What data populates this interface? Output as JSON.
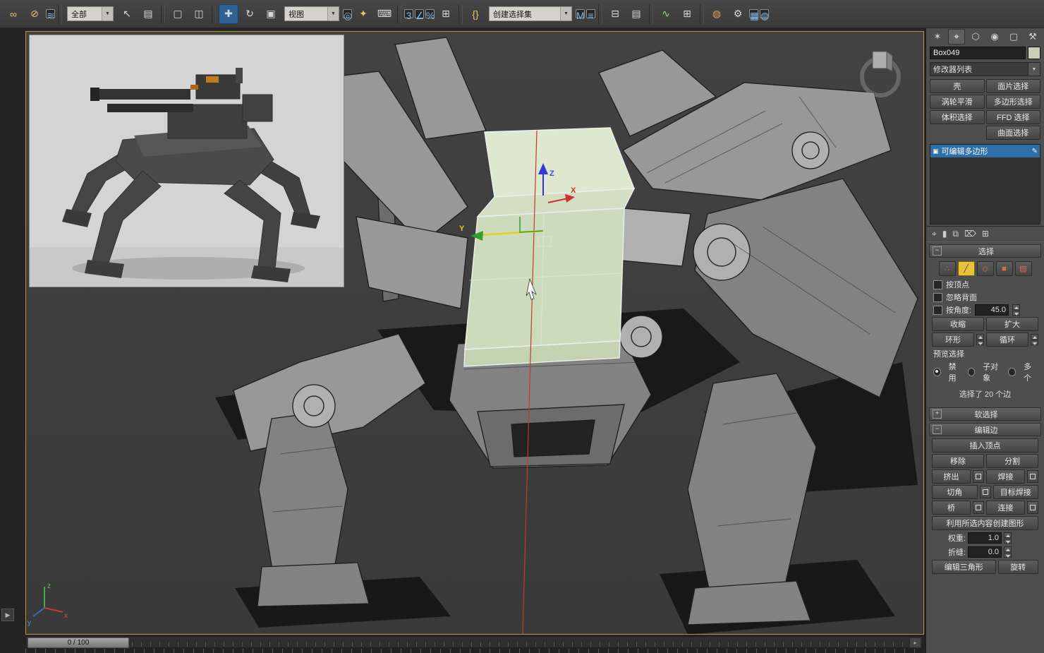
{
  "toolbar": {
    "filter_dropdown": "全部",
    "coord_dropdown": "视图",
    "selection_set_dropdown": "创建选择集",
    "icons": [
      {
        "name": "select-and-link",
        "glyph": "∞"
      },
      {
        "name": "unlink-selection",
        "glyph": "⊘"
      },
      {
        "name": "bind-to-space-warp",
        "glyph": "≋"
      },
      {
        "name": "select-object",
        "glyph": "↖"
      },
      {
        "name": "select-by-name",
        "glyph": "▤"
      },
      {
        "name": "selection-region",
        "glyph": "▢"
      },
      {
        "name": "window-crossing",
        "glyph": "◫"
      },
      {
        "name": "select-and-move",
        "glyph": "✚"
      },
      {
        "name": "select-and-rotate",
        "glyph": "↻"
      },
      {
        "name": "select-and-scale",
        "glyph": "▣"
      },
      {
        "name": "use-pivot-point-center",
        "glyph": "◎"
      },
      {
        "name": "select-and-manipulate",
        "glyph": "✦"
      },
      {
        "name": "keyboard-shortcut-override",
        "glyph": "⌨"
      },
      {
        "name": "snaps-toggle-3d",
        "glyph": "3"
      },
      {
        "name": "angle-snap-toggle",
        "glyph": "∠"
      },
      {
        "name": "percent-snap-toggle",
        "glyph": "%"
      },
      {
        "name": "spinner-snap-toggle",
        "glyph": "⊞"
      },
      {
        "name": "edit-named-selection-sets",
        "glyph": "{}"
      },
      {
        "name": "mirror",
        "glyph": "M"
      },
      {
        "name": "align",
        "glyph": "≡"
      },
      {
        "name": "layer-manager",
        "glyph": "⊟"
      },
      {
        "name": "graphite-ribbon",
        "glyph": "▤"
      },
      {
        "name": "curve-editor",
        "glyph": "∿"
      },
      {
        "name": "schematic-view",
        "glyph": "⊞"
      },
      {
        "name": "material-editor",
        "glyph": "◍"
      },
      {
        "name": "render-setup",
        "glyph": "⚙"
      },
      {
        "name": "rendered-frame-window",
        "glyph": "▦"
      },
      {
        "name": "render-production",
        "glyph": "◍"
      }
    ]
  },
  "viewport": {
    "gizmo": {
      "x": "X",
      "y": "Y",
      "z": "Z"
    },
    "axis_tripod": {
      "x": "x",
      "y": "y",
      "z": "z"
    },
    "arrow_button": "▶"
  },
  "timeline": {
    "scrubber": "0 / 100",
    "end_arrow": "▸"
  },
  "panel": {
    "tabs": [
      {
        "name": "create",
        "glyph": "✶"
      },
      {
        "name": "modify",
        "glyph": "⌖"
      },
      {
        "name": "hierarchy",
        "glyph": "⬡"
      },
      {
        "name": "motion",
        "glyph": "◉"
      },
      {
        "name": "display",
        "glyph": "▢"
      },
      {
        "name": "utilities",
        "glyph": "⚒"
      }
    ],
    "object_name": "Box049",
    "object_color": "#c9cdb9",
    "modifier_list": "修改器列表",
    "modifier_buttons": [
      "壳",
      "面片选择",
      "涡轮平滑",
      "多边形选择",
      "体积选择",
      "FFD 选择",
      "曲面选择"
    ],
    "stack": {
      "item": "可编辑多边形"
    },
    "stack_tools": [
      {
        "name": "pin-stack",
        "glyph": "⌖"
      },
      {
        "name": "show-end-result",
        "glyph": "▮"
      },
      {
        "name": "make-unique",
        "glyph": "⧉"
      },
      {
        "name": "remove-modifier",
        "glyph": "⌦"
      },
      {
        "name": "configure-modifier-sets",
        "glyph": "⊞"
      }
    ],
    "selection": {
      "title": "选择",
      "subobject": [
        {
          "name": "vertex",
          "glyph": "∴"
        },
        {
          "name": "edge",
          "glyph": "╱"
        },
        {
          "name": "border",
          "glyph": "◇"
        },
        {
          "name": "polygon",
          "glyph": "■"
        },
        {
          "name": "element",
          "glyph": "▧"
        }
      ],
      "by_vertex": "按顶点",
      "ignore_backfacing": "忽略背面",
      "by_angle": "按角度:",
      "angle_value": "45.0",
      "shrink": "收缩",
      "grow": "扩大",
      "ring": "环形",
      "loop": "循环",
      "preview_label": "预览选择",
      "radio_disable": "禁用",
      "radio_subobj": "子对象",
      "radio_multi": "多个",
      "status": "选择了 20 个边"
    },
    "soft_selection": {
      "title": "软选择"
    },
    "edit_edges": {
      "title": "编辑边",
      "insert_vertex": "插入顶点",
      "remove": "移除",
      "split": "分割",
      "extrude": "挤出",
      "weld": "焊接",
      "chamfer": "切角",
      "target_weld": "目标焊接",
      "bridge": "桥",
      "connect": "连接",
      "create_shape": "利用所选内容创建图形",
      "weight_label": "权重:",
      "weight_value": "1.0",
      "crease_label": "折缝:",
      "crease_value": "0.0",
      "edit_triangulation": "编辑三角形",
      "turn": "旋转"
    }
  }
}
